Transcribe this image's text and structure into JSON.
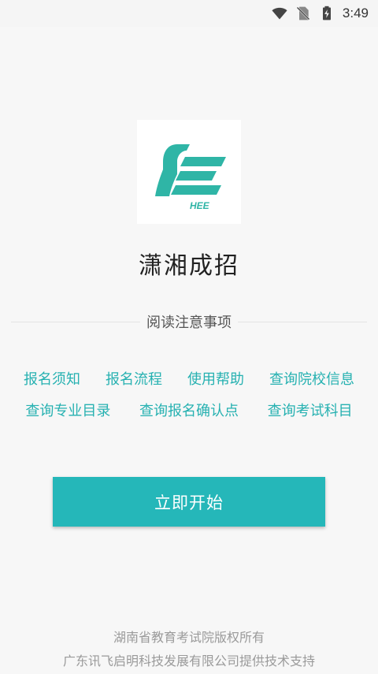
{
  "status_bar": {
    "time": "3:49",
    "icons": [
      "wifi-icon",
      "no-sim-icon",
      "battery-charging-icon"
    ]
  },
  "app": {
    "logo_icon": "hee-logo-icon",
    "logo_text": "HEE",
    "title": "潇湘成招"
  },
  "notice": {
    "heading": "阅读注意事项",
    "links_row1": [
      "报名须知",
      "报名流程",
      "使用帮助",
      "查询院校信息"
    ],
    "links_row2": [
      "查询专业目录",
      "查询报名确认点",
      "查询考试科目"
    ]
  },
  "start_button": {
    "label": "立即开始"
  },
  "footer": {
    "copyright": "湖南省教育考试院版权所有",
    "support": "广东讯飞启明科技发展有限公司提供技术支持"
  },
  "colors": {
    "accent": "#25b7b9",
    "link": "#26b1b1",
    "background": "#f7f7f7"
  }
}
